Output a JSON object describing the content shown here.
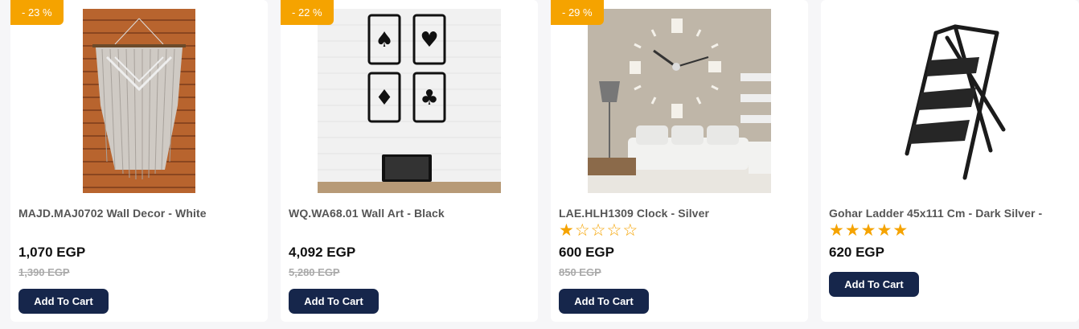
{
  "products": [
    {
      "discount": "- 23 %",
      "title": "MAJD.MAJ0702 Wall Decor - White",
      "price": "1,070 EGP",
      "old_price": "1,390 EGP",
      "button": "Add To Cart",
      "image": "macrame-wall-hanging-image"
    },
    {
      "discount": "- 22 %",
      "title": "WQ.WA68.01 Wall Art - Black",
      "price": "4,092 EGP",
      "old_price": "5,280 EGP",
      "button": "Add To Cart",
      "image": "playing-cards-wall-art-image"
    },
    {
      "discount": "- 29 %",
      "title": "LAE.HLH1309 Clock - Silver",
      "rating": 1,
      "price": "600 EGP",
      "old_price": "850 EGP",
      "button": "Add To Cart",
      "image": "wall-clock-living-room-image"
    },
    {
      "title": "Gohar Ladder 45x111 Cm - Dark Silver -",
      "rating": 5,
      "price": "620 EGP",
      "button": "Add To Cart",
      "image": "step-ladder-image"
    }
  ],
  "colors": {
    "badge": "#f5a300",
    "button": "#16264b",
    "star": "#f5a300"
  }
}
